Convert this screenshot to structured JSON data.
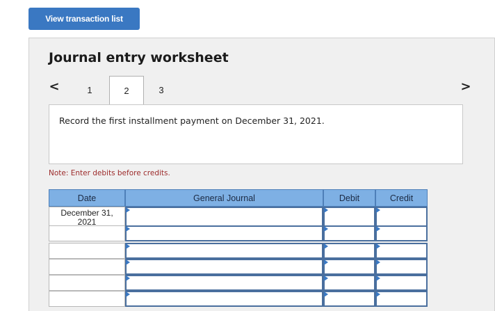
{
  "header": {
    "view_button": "View transaction list"
  },
  "worksheet": {
    "title": "Journal entry worksheet",
    "tabs": [
      "1",
      "2",
      "3"
    ],
    "active_tab": "2",
    "prev_icon": "<",
    "next_icon": ">",
    "instruction": "Record the first installment payment on December 31, 2021.",
    "note": "Note: Enter debits before credits."
  },
  "table": {
    "headers": {
      "date": "Date",
      "general_journal": "General Journal",
      "debit": "Debit",
      "credit": "Credit"
    },
    "rows": [
      {
        "date_line1": "December 31,",
        "date_line2": "2021",
        "general_journal": "",
        "debit": "",
        "credit": ""
      },
      {
        "date_line1": "",
        "date_line2": "",
        "general_journal": "",
        "debit": "",
        "credit": ""
      },
      {
        "date_line1": "",
        "date_line2": "",
        "general_journal": "",
        "debit": "",
        "credit": ""
      },
      {
        "date_line1": "",
        "date_line2": "",
        "general_journal": "",
        "debit": "",
        "credit": ""
      },
      {
        "date_line1": "",
        "date_line2": "",
        "general_journal": "",
        "debit": "",
        "credit": ""
      },
      {
        "date_line1": "",
        "date_line2": "",
        "general_journal": "",
        "debit": "",
        "credit": ""
      }
    ]
  },
  "colors": {
    "button": "#3a78c2",
    "header": "#7eb0e4",
    "note": "#9c2a2a",
    "panel": "#f0f0f0"
  }
}
